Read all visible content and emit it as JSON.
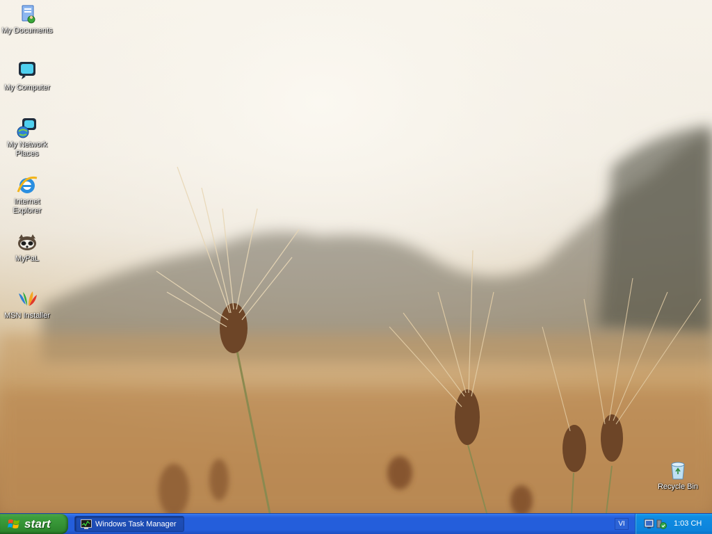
{
  "desktop": {
    "icons": [
      {
        "label": "My Documents",
        "icon": "my-documents-icon"
      },
      {
        "label": "My Computer",
        "icon": "my-computer-icon"
      },
      {
        "label": "My Network Places",
        "icon": "network-places-icon"
      },
      {
        "label": "Internet Explorer",
        "icon": "internet-explorer-icon"
      },
      {
        "label": "MyPaL",
        "icon": "mypal-icon"
      },
      {
        "label": "MSN Installer",
        "icon": "msn-installer-icon"
      },
      {
        "label": "Recycle Bin",
        "icon": "recycle-bin-icon"
      }
    ]
  },
  "taskbar": {
    "start_label": "start",
    "tasks": [
      {
        "label": "Windows Task Manager",
        "icon": "task-manager-icon"
      }
    ],
    "language": "VI",
    "clock": "1:03 CH",
    "tray_icons": [
      "display-icon",
      "security-shield-icon"
    ]
  },
  "colors": {
    "taskbar_blue": "#245edb",
    "start_green": "#369436",
    "tray_blue": "#0c84dc"
  }
}
